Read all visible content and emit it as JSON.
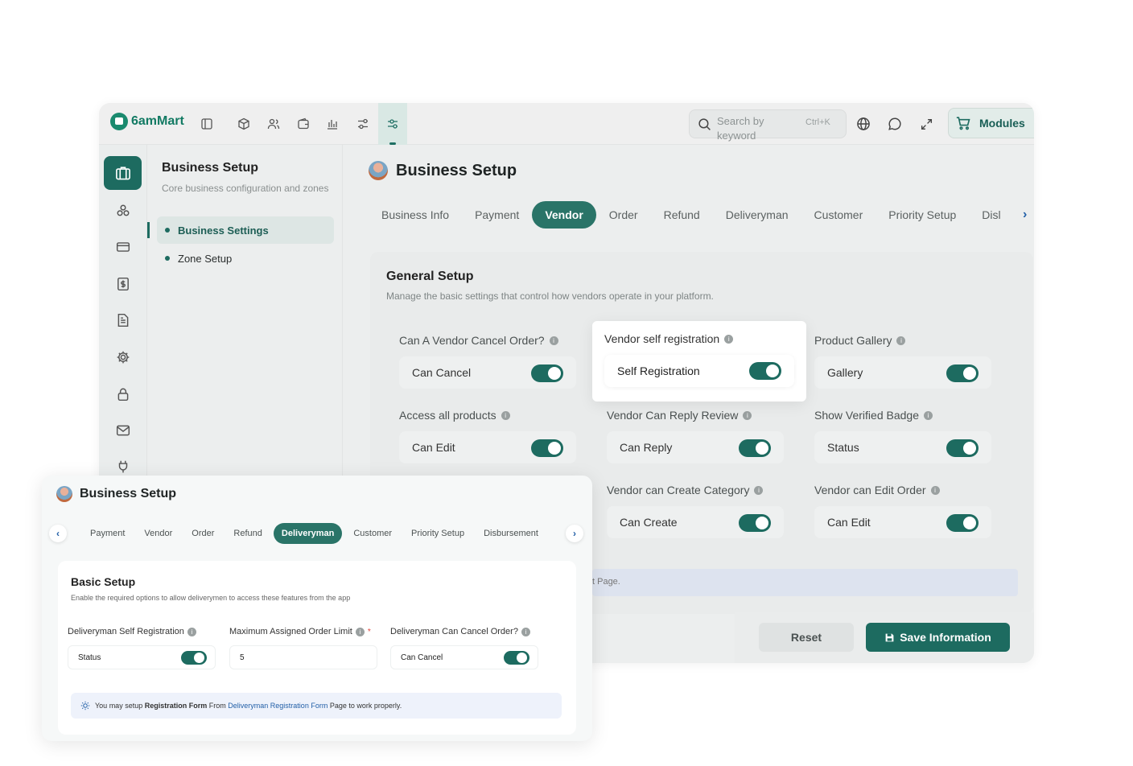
{
  "colors": {
    "brand": "#1d6b60",
    "brand_logo": "#127a63",
    "link": "#2360a8",
    "required": "#e0443a"
  },
  "topbar": {
    "logo_text": "6amMart",
    "icons": [
      "sidebar-toggle-icon",
      "box-icon",
      "users-icon",
      "wallet-icon",
      "chart-icon",
      "settings-sliders-icon",
      "filter-sliders-icon"
    ],
    "search": {
      "placeholder": "Search by keyword",
      "shortcut": "Ctrl+K"
    },
    "modules_label": "Modules"
  },
  "submenu": {
    "title": "Business Setup",
    "subtitle": "Core business configuration and zones",
    "items": [
      {
        "label": "Business Settings",
        "active": true
      },
      {
        "label": "Zone Setup",
        "active": false
      }
    ]
  },
  "main": {
    "title": "Business Setup",
    "tabs": [
      "Business Info",
      "Payment",
      "Vendor",
      "Order",
      "Refund",
      "Deliveryman",
      "Customer",
      "Priority Setup",
      "Disl"
    ],
    "active_tab": "Vendor",
    "panel": {
      "title": "General Setup",
      "description": "Manage the basic settings that control how vendors operate in your platform.",
      "settings": [
        {
          "label": "Can A Vendor Cancel Order?",
          "value": "Can Cancel",
          "on": true
        },
        {
          "label": "Vendor self registration",
          "value": "Self Registration",
          "on": true
        },
        {
          "label": "Product Gallery",
          "value": "Gallery",
          "on": true
        },
        {
          "label": "Access all products",
          "value": "Can Edit",
          "on": true
        },
        {
          "label": "Vendor Can Reply Review",
          "value": "Can Reply",
          "on": true
        },
        {
          "label": "Show Verified Badge",
          "value": "Status",
          "on": true
        },
        {
          "label": "Vendor can Create Category",
          "value": "Can Create",
          "on": true
        },
        {
          "label": "Vendor can Edit Order",
          "value": "Can Edit",
          "on": true
        }
      ],
      "strip_text": "t Page."
    },
    "buttons": {
      "reset": "Reset",
      "save": "Save Information"
    }
  },
  "card": {
    "title": "Business Setup",
    "tabs": [
      "Payment",
      "Vendor",
      "Order",
      "Refund",
      "Deliveryman",
      "Customer",
      "Priority Setup",
      "Disbursement"
    ],
    "active_tab": "Deliveryman",
    "panel": {
      "title": "Basic Setup",
      "description": "Enable the required options to allow deliverymen to access these features from the app",
      "fields": [
        {
          "label": "Deliveryman Self Registration",
          "value": "Status",
          "type": "toggle",
          "required": false
        },
        {
          "label": "Maximum Assigned Order Limit",
          "value": "5",
          "type": "input",
          "required": true
        },
        {
          "label": "Deliveryman Can Cancel Order?",
          "value": "Can Cancel",
          "type": "toggle",
          "required": false
        }
      ],
      "note": {
        "part1": "You may setup",
        "bold1": "Registration Form",
        "part2": "From",
        "link": "Deliveryman Registration Form",
        "part3": "Page to work properly."
      }
    }
  }
}
